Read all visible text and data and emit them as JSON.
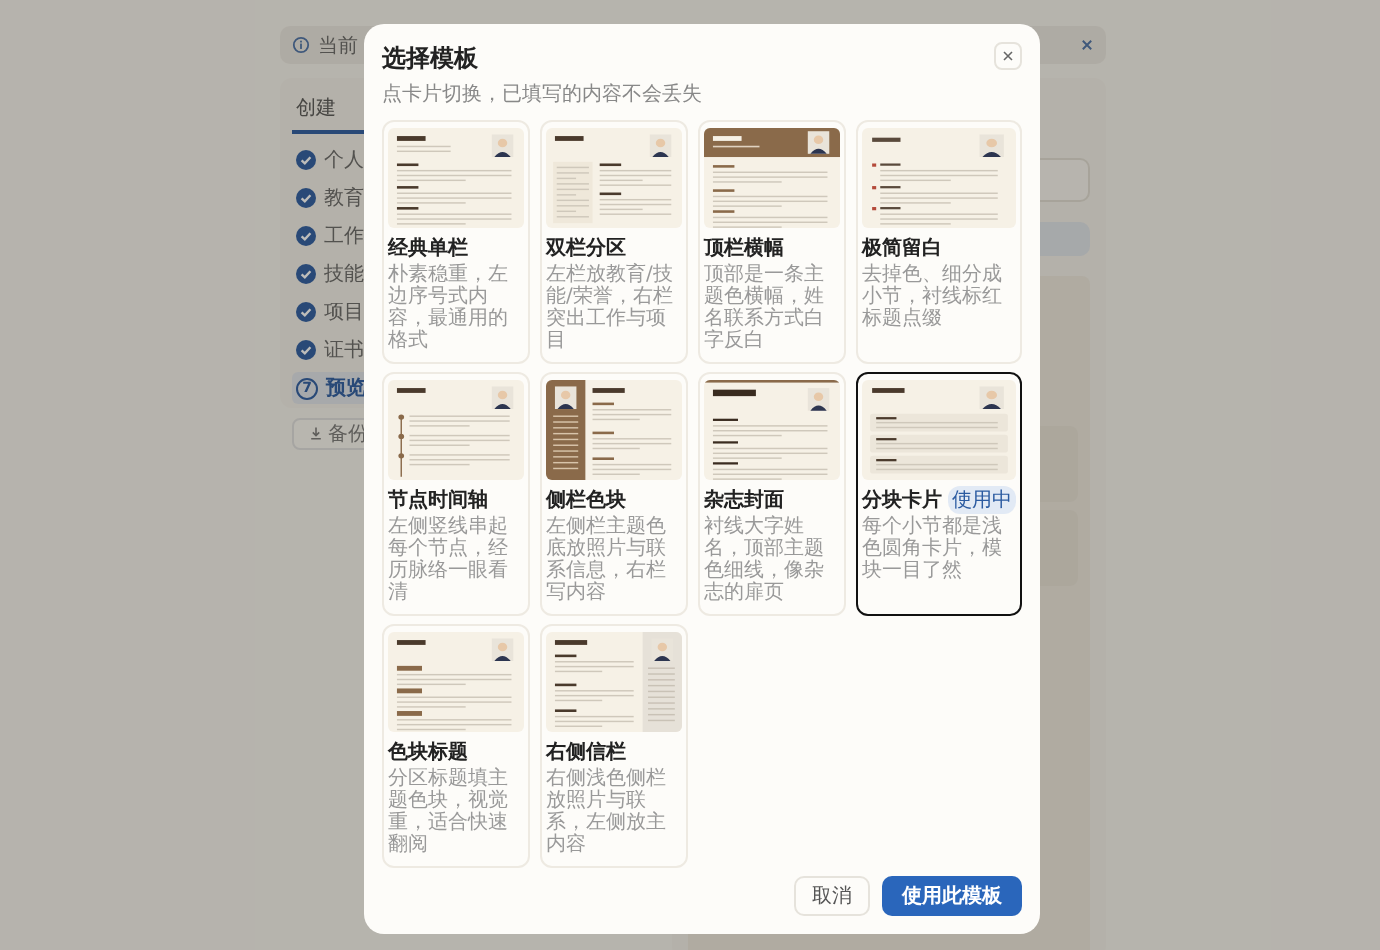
{
  "background": {
    "notice": "当前",
    "tab": "创建",
    "steps": [
      {
        "label": "个人",
        "done": true,
        "selected": false
      },
      {
        "label": "教育",
        "done": true,
        "selected": false
      },
      {
        "label": "工作",
        "done": true,
        "selected": false
      },
      {
        "label": "技能",
        "done": true,
        "selected": false
      },
      {
        "label": "项目",
        "done": true,
        "selected": false
      },
      {
        "label": "证书",
        "done": true,
        "selected": false
      },
      {
        "label": "预览",
        "done": false,
        "number": "7",
        "selected": true
      }
    ],
    "backup_button": "备份"
  },
  "modal": {
    "title": "选择模板",
    "subtitle": "点卡片切换，已填写的内容不会丢失",
    "templates": [
      {
        "kind": "classic",
        "name": "经典单栏",
        "description": "朴素稳重，左边序号式内容，最通用的格式",
        "selected": false
      },
      {
        "kind": "twocol",
        "name": "双栏分区",
        "description": "左栏放教育/技能/荣誉，右栏突出工作与项目",
        "selected": false
      },
      {
        "kind": "banner",
        "name": "顶栏横幅",
        "description": "顶部是一条主题色横幅，姓名联系方式白字反白",
        "selected": false
      },
      {
        "kind": "minimal",
        "name": "极简留白",
        "description": "去掉色、细分成小节，衬线标红标题点缀",
        "selected": false
      },
      {
        "kind": "timeline",
        "name": "节点时间轴",
        "description": "左侧竖线串起每个节点，经历脉络一眼看清",
        "selected": false
      },
      {
        "kind": "sidebar",
        "name": "侧栏色块",
        "description": "左侧栏主题色底放照片与联系信息，右栏写内容",
        "selected": false
      },
      {
        "kind": "magazine",
        "name": "杂志封面",
        "description": "衬线大字姓名，顶部主题色细线，像杂志的扉页",
        "selected": false
      },
      {
        "kind": "cards",
        "name": "分块卡片",
        "badge": "使用中",
        "description": "每个小节都是浅色圆角卡片，模块一目了然",
        "selected": true
      },
      {
        "kind": "colortitle",
        "name": "色块标题",
        "description": "分区标题填主题色块，视觉重，适合快速翻阅",
        "selected": false
      },
      {
        "kind": "rightsidebar",
        "name": "右侧信栏",
        "description": "右侧浅色侧栏放照片与联系，左侧放主内容",
        "selected": false
      }
    ],
    "cancel_button": "取消",
    "confirm_button": "使用此模板"
  }
}
